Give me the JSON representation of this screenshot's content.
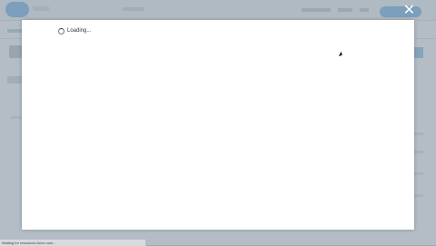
{
  "modal": {
    "loading_text": "Loading..."
  },
  "controls": {
    "close_glyph": "✕"
  },
  "status_bar": {
    "text": "Waiting for resources.force.com..."
  },
  "colors": {
    "brand_blue": "#7fb6e6",
    "modal_bg": "#ffffff",
    "overlay": "#8b98a5"
  }
}
